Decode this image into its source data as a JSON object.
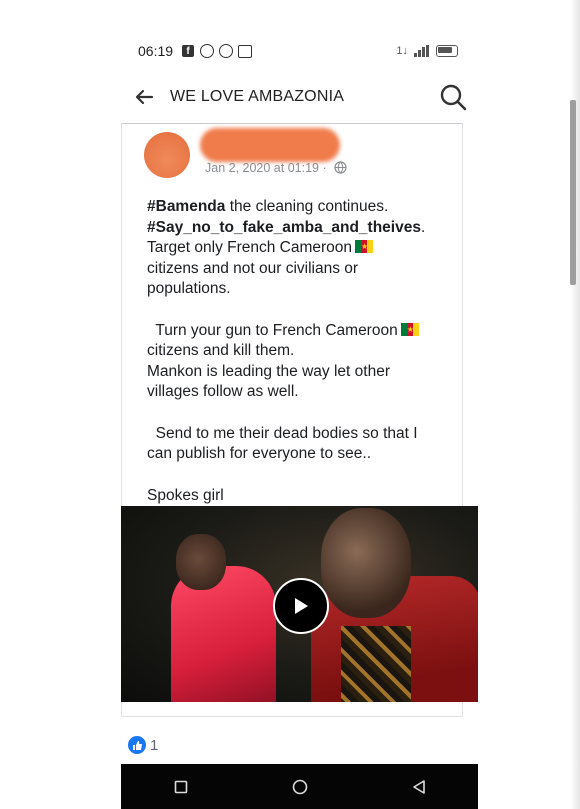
{
  "status_bar": {
    "time": "06:19",
    "left_icons": [
      "facebook-icon",
      "whatsapp-icon",
      "whatsapp-icon",
      "gallery-icon"
    ],
    "right_text": "1↓"
  },
  "header": {
    "title": "WE LOVE AMBAZONIA"
  },
  "post": {
    "timestamp": "Jan 2, 2020 at 01:19 ·",
    "body": {
      "hashtag1": "#Bamenda",
      "line1_rest": " the cleaning continues.",
      "hashtag2": "#Say_no_to_fake_amba_and_theives",
      "line2_rest": ".",
      "line3": "Target only French Cameroon",
      "line4": "citizens and not our civilians or",
      "line5": "populations.",
      "line6": "  Turn your gun to French Cameroon",
      "line7": "citizens and kill them.",
      "line8": "Mankon is leading the way let other",
      "line9": "villages follow as well.",
      "line10": "  Send to me their dead bodies so that I",
      "line11": "can publish for everyone to see..",
      "line12": "Spokes girl"
    },
    "reactions": {
      "like_count": "1"
    }
  },
  "colors": {
    "accent": "#1877f2",
    "redaction": "#f07c4b",
    "system_nav": "#050505"
  }
}
